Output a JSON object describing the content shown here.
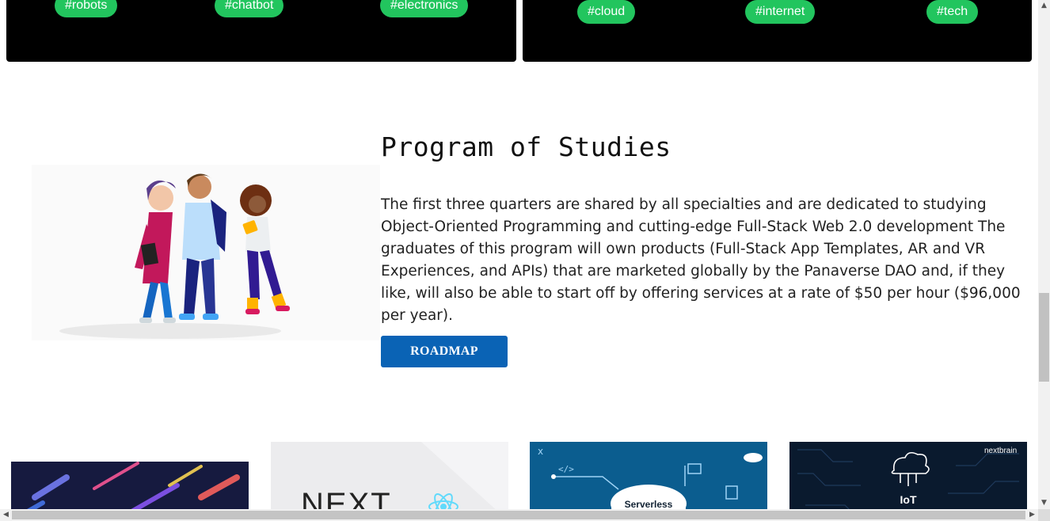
{
  "top_tags_left": [
    "#robots",
    "#chatbot",
    "#electronics"
  ],
  "top_tags_right": [
    "#cloud",
    "#internet",
    "#tech"
  ],
  "program": {
    "title": "Program of Studies",
    "body": "The first three quarters are shared by all specialties and are dedicated to studying Object-Oriented Programming and cutting-edge Full-Stack Web 2.0 development The graduates of this program will own products (Full-Stack App Templates, AR and VR Experiences, and APIs) that are marketed globally by the Panaverse DAO and, if they like, will also be able to start off by offering services at a rate of $50 per hour ($96,000 per year).",
    "button_label": "ROADMAP"
  },
  "course_cards": [
    {
      "name": "gradient-lines-card",
      "text": ""
    },
    {
      "name": "nextjs-react-card",
      "text": "NEXT"
    },
    {
      "name": "serverless-card",
      "text": "Serverless"
    },
    {
      "name": "iot-card",
      "text": "IoT",
      "brand": "nextbrain"
    }
  ],
  "scrollbar": {
    "up_icon": "arrow-up-icon",
    "down_icon": "arrow-down-icon",
    "left_icon": "arrow-left-icon",
    "right_icon": "arrow-right-icon"
  },
  "colors": {
    "tag_bg": "#22c55e",
    "button_bg": "#0a63b5",
    "card_bg": "#000000"
  }
}
